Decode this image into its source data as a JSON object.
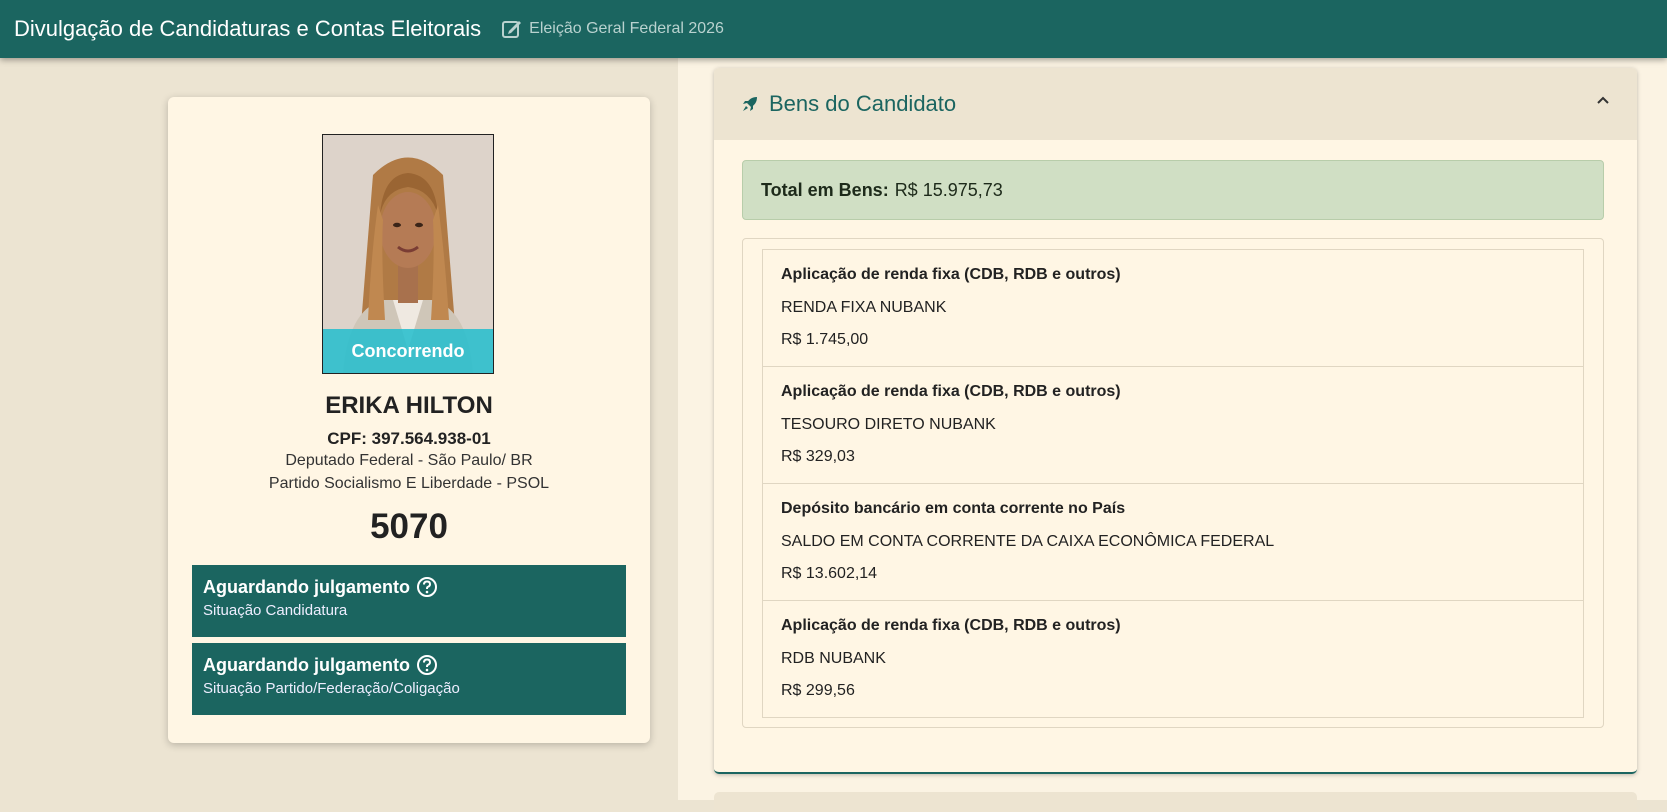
{
  "header": {
    "title": "Divulgação de Candidaturas e Contas Eleitorais",
    "edit_icon": "edit-square-icon",
    "subtitle": "Eleição Geral Federal 2026"
  },
  "candidate": {
    "photo_status": "Concorrendo",
    "name": "ERIKA HILTON",
    "cpf": "CPF: 397.564.938-01",
    "cargo": "Deputado Federal - São Paulo/ BR",
    "partido": "Partido Socialismo E Liberdade - PSOL",
    "numero": "5070",
    "situacoes": [
      {
        "status": "Aguardando julgamento",
        "label": "Situação Candidatura"
      },
      {
        "status": "Aguardando julgamento",
        "label": "Situação Partido/Federação/Coligação"
      }
    ]
  },
  "bens": {
    "title": "Bens do Candidato",
    "total_label": "Total em Bens:",
    "total_value": "R$ 15.975,73",
    "items": [
      {
        "tipo": "Aplicação de renda fixa (CDB, RDB e outros)",
        "descricao": "RENDA FIXA NUBANK",
        "valor": "R$ 1.745,00"
      },
      {
        "tipo": "Aplicação de renda fixa (CDB, RDB e outros)",
        "descricao": "TESOURO DIRETO NUBANK",
        "valor": "R$ 329,03"
      },
      {
        "tipo": "Depósito bancário em conta corrente no País",
        "descricao": "SALDO EM CONTA CORRENTE DA CAIXA ECONÔMICA FEDERAL",
        "valor": "R$ 13.602,14"
      },
      {
        "tipo": "Aplicação de renda fixa (CDB, RDB e outros)",
        "descricao": "RDB NUBANK",
        "valor": "R$ 299,56"
      }
    ]
  },
  "colors": {
    "primary": "#1b6560",
    "background": "#ece4d2",
    "card": "#fff6e4",
    "status_banner": "#28becd",
    "total_box": "#d0dfc4"
  }
}
